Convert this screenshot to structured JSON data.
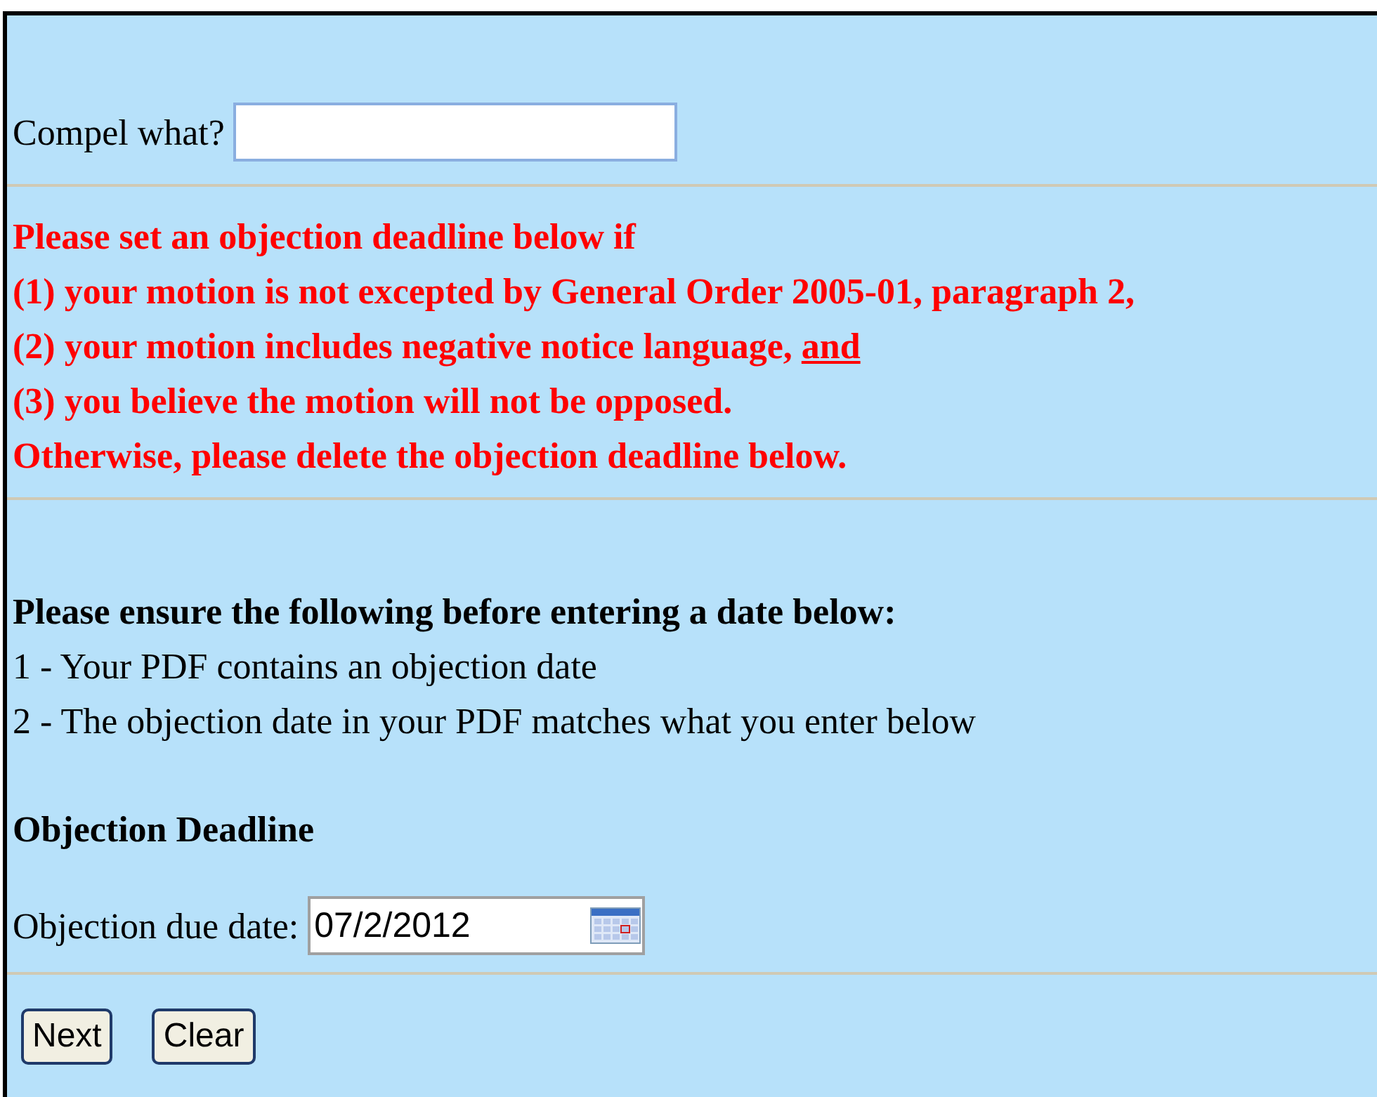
{
  "compel": {
    "label": "Compel what?"
  },
  "notice": {
    "lines": [
      {
        "text": "Please set an objection deadline below if"
      },
      {
        "text": "(1) your motion is not excepted by General Order 2005-01, paragraph 2,"
      },
      {
        "text": "(2) your motion includes negative notice language,",
        "underlined": "and"
      },
      {
        "text": "(3) you believe the motion will not be opposed."
      },
      {
        "text": "Otherwise, please delete the objection deadline below."
      }
    ]
  },
  "checklist": {
    "heading": "Please ensure the following before entering a date below:",
    "items": [
      "1 - Your PDF contains an objection date",
      "2 - The objection date in your PDF matches what you enter below"
    ]
  },
  "deadline": {
    "heading": "Objection Deadline",
    "label": "Objection due date:",
    "value": "07/2/2012"
  },
  "buttons": [
    "Next",
    "Clear"
  ]
}
